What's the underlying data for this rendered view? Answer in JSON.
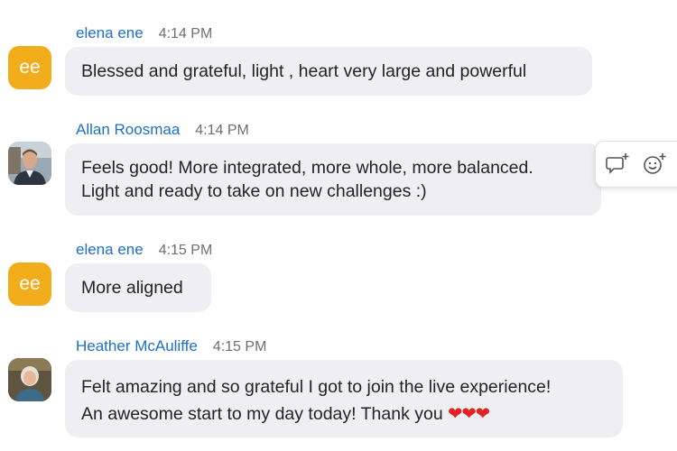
{
  "messages": [
    {
      "sender": "elena ene",
      "time": "4:14 PM",
      "avatar_initials": "ee",
      "lines": [
        "Blessed and grateful, light , heart very large and powerful"
      ]
    },
    {
      "sender": "Allan Roosmaa",
      "time": "4:14 PM",
      "lines": [
        "Feels good! More integrated, more whole, more balanced.",
        "Light and ready to take on new challenges :)"
      ]
    },
    {
      "sender": "elena ene",
      "time": "4:15 PM",
      "avatar_initials": "ee",
      "lines": [
        "More aligned"
      ]
    },
    {
      "sender": "Heather McAuliffe",
      "time": "4:15 PM",
      "lines": [
        "Felt amazing and so grateful I got to join the live experience!",
        "An awesome start to my day today! Thank you"
      ],
      "emoji": "❤❤❤"
    }
  ],
  "hover_actions": [
    {
      "icon": "reply-in-thread-icon"
    },
    {
      "icon": "add-reaction-icon"
    }
  ],
  "colors": {
    "sender": "#1f6fc6",
    "bubble": "#eeeef3",
    "initials_avatar": "#f2ad1d"
  }
}
